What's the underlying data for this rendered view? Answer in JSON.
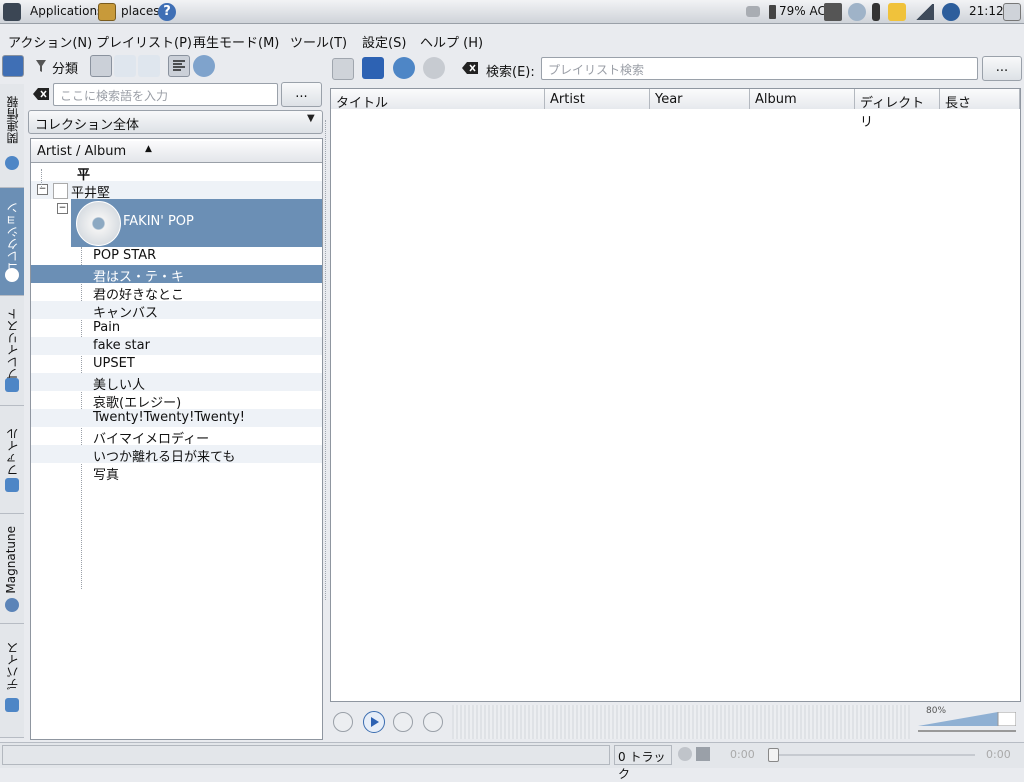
{
  "panel": {
    "applications": "Applications",
    "places": "places",
    "battery": "79% AC",
    "clock": "21:12"
  },
  "menubar": {
    "items": [
      "アクション(N)",
      "プレイリスト(P)",
      "再生モード(M)",
      "ツール(T)",
      "設定(S)",
      "ヘルプ (H)"
    ]
  },
  "left_toolbar": {
    "filter_label": "分類"
  },
  "side_tabs": {
    "related": "関連情報",
    "collection": "コレクション",
    "playlist": "プレイリスト",
    "files": "ファイル",
    "magnatune": "Magnatune",
    "devices": "デバイス"
  },
  "collection": {
    "search_placeholder": "ここに検索語を入力",
    "more_button": "...",
    "filter_value": "コレクション全体",
    "column_header": "Artist / Album",
    "group_letter": "平",
    "artist": "平井堅",
    "album": "FAKIN' POP",
    "tracks": [
      "POP STAR",
      "君はス・テ・キ",
      "君の好きなとこ",
      "キャンバス",
      "Pain",
      "fake star",
      "UPSET",
      "美しい人",
      "哀歌(エレジー)",
      "Twenty!Twenty!Twenty!",
      "バイマイメロディー",
      "いつか離れる日が来ても",
      "写真"
    ]
  },
  "playlist": {
    "search_label": "検索(E):",
    "search_placeholder": "プレイリスト検索",
    "more_button": "...",
    "columns": [
      "タイトル",
      "Artist",
      "Year",
      "Album",
      "ディレクトリ",
      "長さ"
    ]
  },
  "player": {
    "volume": "80%"
  },
  "status": {
    "tracks": "0 トラック",
    "time_left": "0:00",
    "time_right": "0:00"
  }
}
